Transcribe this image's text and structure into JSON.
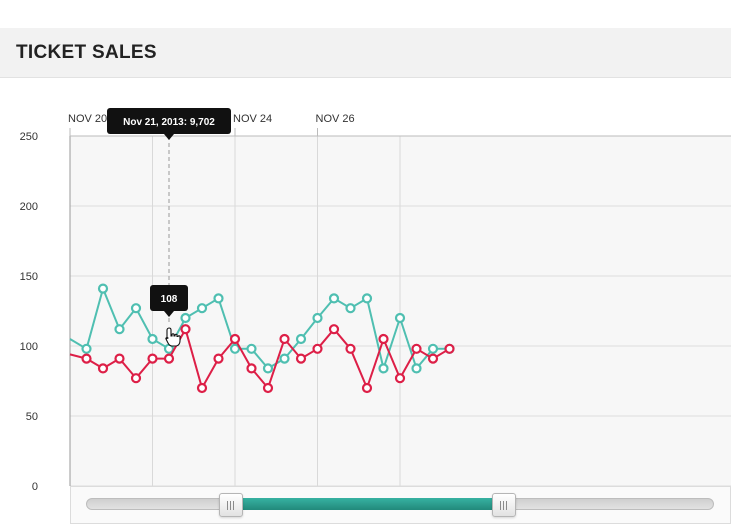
{
  "header": {
    "title": "TICKET SALES"
  },
  "chart_data": {
    "type": "line",
    "x_ticks": [
      {
        "index": 0,
        "label": "NOV 20"
      },
      {
        "index": 10,
        "label": "NOV 24"
      },
      {
        "index": 15,
        "label": "NOV 26"
      }
    ],
    "ylim": [
      0,
      250
    ],
    "y_ticks": [
      0,
      50,
      100,
      150,
      200,
      250
    ],
    "grid": true,
    "series": [
      {
        "color": "#4fbfb1",
        "values": [
          105,
          98,
          141,
          112,
          127,
          105,
          98,
          120,
          127,
          134,
          98,
          98,
          84,
          91,
          105,
          120,
          134,
          127,
          134,
          84,
          120,
          84,
          98,
          98
        ]
      },
      {
        "color": "#dd1f47",
        "values": [
          94,
          91,
          84,
          91,
          77,
          91,
          91,
          112,
          70,
          91,
          105,
          84,
          70,
          105,
          91,
          98,
          112,
          98,
          70,
          105,
          77,
          98,
          91,
          98
        ]
      }
    ],
    "tooltip_date": {
      "text": "Nov 21, 2013: 9,702",
      "index": 6
    },
    "tooltip_point": {
      "text": "108",
      "index": 6
    },
    "range_selector": {
      "start": 0.25,
      "end": 0.65
    }
  }
}
